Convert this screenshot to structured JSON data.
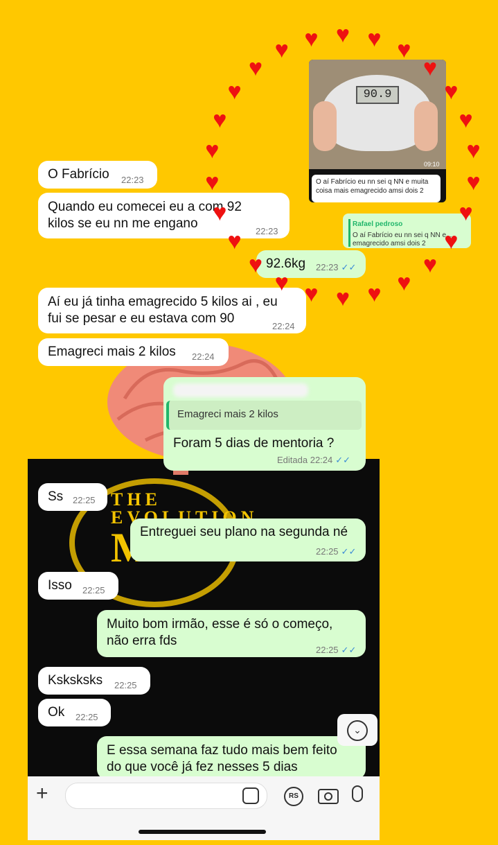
{
  "messages": [
    {
      "text": "O Fabrício",
      "time": "22:23"
    },
    {
      "line1": "Quando eu comecei eu  a com 92",
      "line2": "kilos se eu nn me engano",
      "time": "22:23"
    },
    {
      "text": "92.6kg",
      "time": "22:23"
    },
    {
      "line1": "Aí eu já tinha emagrecido 5 kilos ai , eu",
      "line2": "fui se pesar e eu estava com 90",
      "time": "22:24"
    },
    {
      "text": "Emagreci mais 2 kilos",
      "time": "22:24"
    },
    {
      "reply_quote": "Emagreci mais 2 kilos",
      "text": "Foram 5 dias de mentoria  ?",
      "edited": "Editada",
      "time": "22:24"
    },
    {
      "text": "Ss",
      "time": "22:25"
    },
    {
      "text": "Entreguei seu plano na segunda né",
      "time": "22:25"
    },
    {
      "text": "Isso",
      "time": "22:25"
    },
    {
      "line1": "Muito bom irmão, esse é só o começo,",
      "line2": "não erra fds",
      "time": "22:25"
    },
    {
      "text": "Ksksksks",
      "time": "22:25"
    },
    {
      "text": "Ok",
      "time": "22:25"
    },
    {
      "line1": "E essa semana faz tudo mais bem feito",
      "line2": "do que você já fez nesses 5 dias"
    }
  ],
  "ticks": "✓✓",
  "background_logo": {
    "line1": "THE",
    "line2": "EVOLUTION",
    "line3": "M"
  },
  "inset": {
    "scale_reading": "90.9",
    "photo_time": "09:10",
    "bubble_text": "O aí Fabrício eu nn sei q NN e muita coisa mais emagrecido amsi dois 2",
    "bubble_time": "09:10",
    "reply_name": "Rafael pedroso",
    "reply_text": "O aí Fabrício eu nn sei q NN e... emagrecido amsi dois 2"
  },
  "composer": {
    "plus_icon": "+",
    "rs_label": "RS",
    "scroll_icon": "⌄"
  },
  "colors": {
    "page_bg": "#FFC800",
    "outgoing": "#d8fdd0",
    "incoming": "#ffffff",
    "hearts": "#ee1111"
  }
}
